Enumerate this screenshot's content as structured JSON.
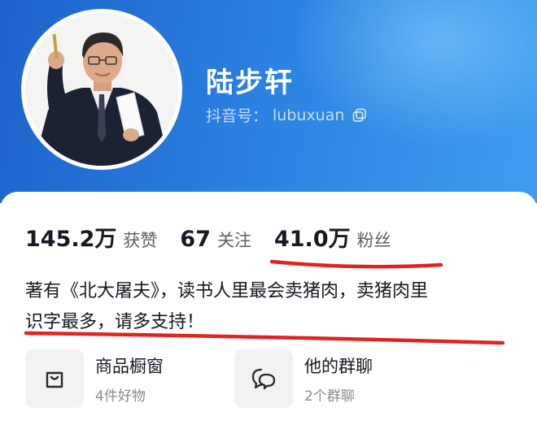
{
  "profile": {
    "name": "陆步轩",
    "douyin_label": "抖音号：",
    "douyin_id": "lubuxuan"
  },
  "stats": [
    {
      "value": "145.2万",
      "label": "获赞"
    },
    {
      "value": "67",
      "label": "关注"
    },
    {
      "value": "41.0万",
      "label": "粉丝"
    }
  ],
  "bio": {
    "line1": "著有《北大屠夫》，读书人里最会卖猪肉，卖猪肉里",
    "line2": "识字最多，请多支持！"
  },
  "features": [
    {
      "title": "商品橱窗",
      "subtitle": "4件好物",
      "icon": "shopping-bag-icon"
    },
    {
      "title": "他的群聊",
      "subtitle": "2个群聊",
      "icon": "chat-bubbles-icon"
    }
  ],
  "colors": {
    "header_gradient_start": "#1e62cc",
    "header_gradient_end": "#3f9df0",
    "annotation_red": "#e0241f",
    "text_primary": "#161823",
    "text_secondary": "#8a8b91"
  }
}
